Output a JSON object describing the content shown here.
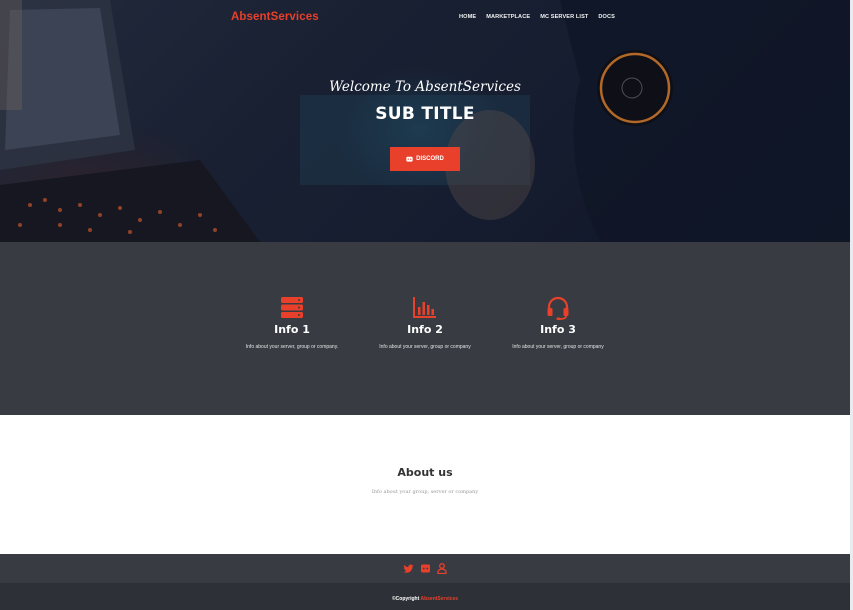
{
  "nav": {
    "brand": "AbsentServices",
    "links": [
      "HOME",
      "MARKETPLACE",
      "MC SERVER LIST",
      "DOCS"
    ]
  },
  "hero": {
    "welcome": "Welcome To AbsentServices",
    "subtitle": "SUB TITLE",
    "button_label": "DISCORD",
    "button_icon": "discord-icon"
  },
  "info": {
    "items": [
      {
        "icon": "server-icon",
        "title": "Info 1",
        "desc": "Info about your server, group or company."
      },
      {
        "icon": "bar-chart-icon",
        "title": "Info 2",
        "desc": "Info about your server, group or company"
      },
      {
        "icon": "headset-icon",
        "title": "Info 3",
        "desc": "Info about your server, group or company"
      }
    ]
  },
  "about": {
    "title": "About us",
    "desc": "Info about your group, server or company"
  },
  "footer": {
    "icons": [
      "twitter-icon",
      "discord-icon",
      "user-icon"
    ],
    "copyright": "©Copyright",
    "brand": "AbsentServices"
  },
  "colors": {
    "accent": "#e8402b",
    "dark_section": "#383b42",
    "footer_bottom": "#2d3036"
  }
}
